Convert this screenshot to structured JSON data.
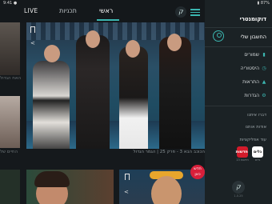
{
  "status": {
    "left": "9:41 ●",
    "right": "87% ▮"
  },
  "topnav": {
    "live": "LIVE",
    "tab_shows": "תכניות",
    "tab_main": "ראשי",
    "logo": "ק"
  },
  "hero": {
    "caption": "הכוכב הבא 3 - פרק 25 | הגמר הגדול"
  },
  "left_captions": {
    "first": "האח הגדול",
    "second": "החיים של"
  },
  "badge_new": "חדש כאן",
  "side": {
    "title": "דוקומנטרי",
    "account": "החשבון שלי",
    "menu": [
      {
        "label": "שמורים",
        "icon": "▮"
      },
      {
        "label": "היסטוריה",
        "icon": "◷"
      },
      {
        "label": "התראות",
        "icon": "▲"
      },
      {
        "label": "הגדרות",
        "icon": "⚙"
      }
    ],
    "links": [
      "דברו איתנו",
      "אודות אותנו",
      "עוד אפליקציות"
    ],
    "apps": [
      {
        "label": "חדשות",
        "caption": "חדשות 13"
      },
      {
        "label": "גלים",
        "caption": "גלים"
      }
    ],
    "version": "1.0.25"
  },
  "colors": {
    "accent": "#3bb6b0",
    "badge": "#d81f3a"
  }
}
